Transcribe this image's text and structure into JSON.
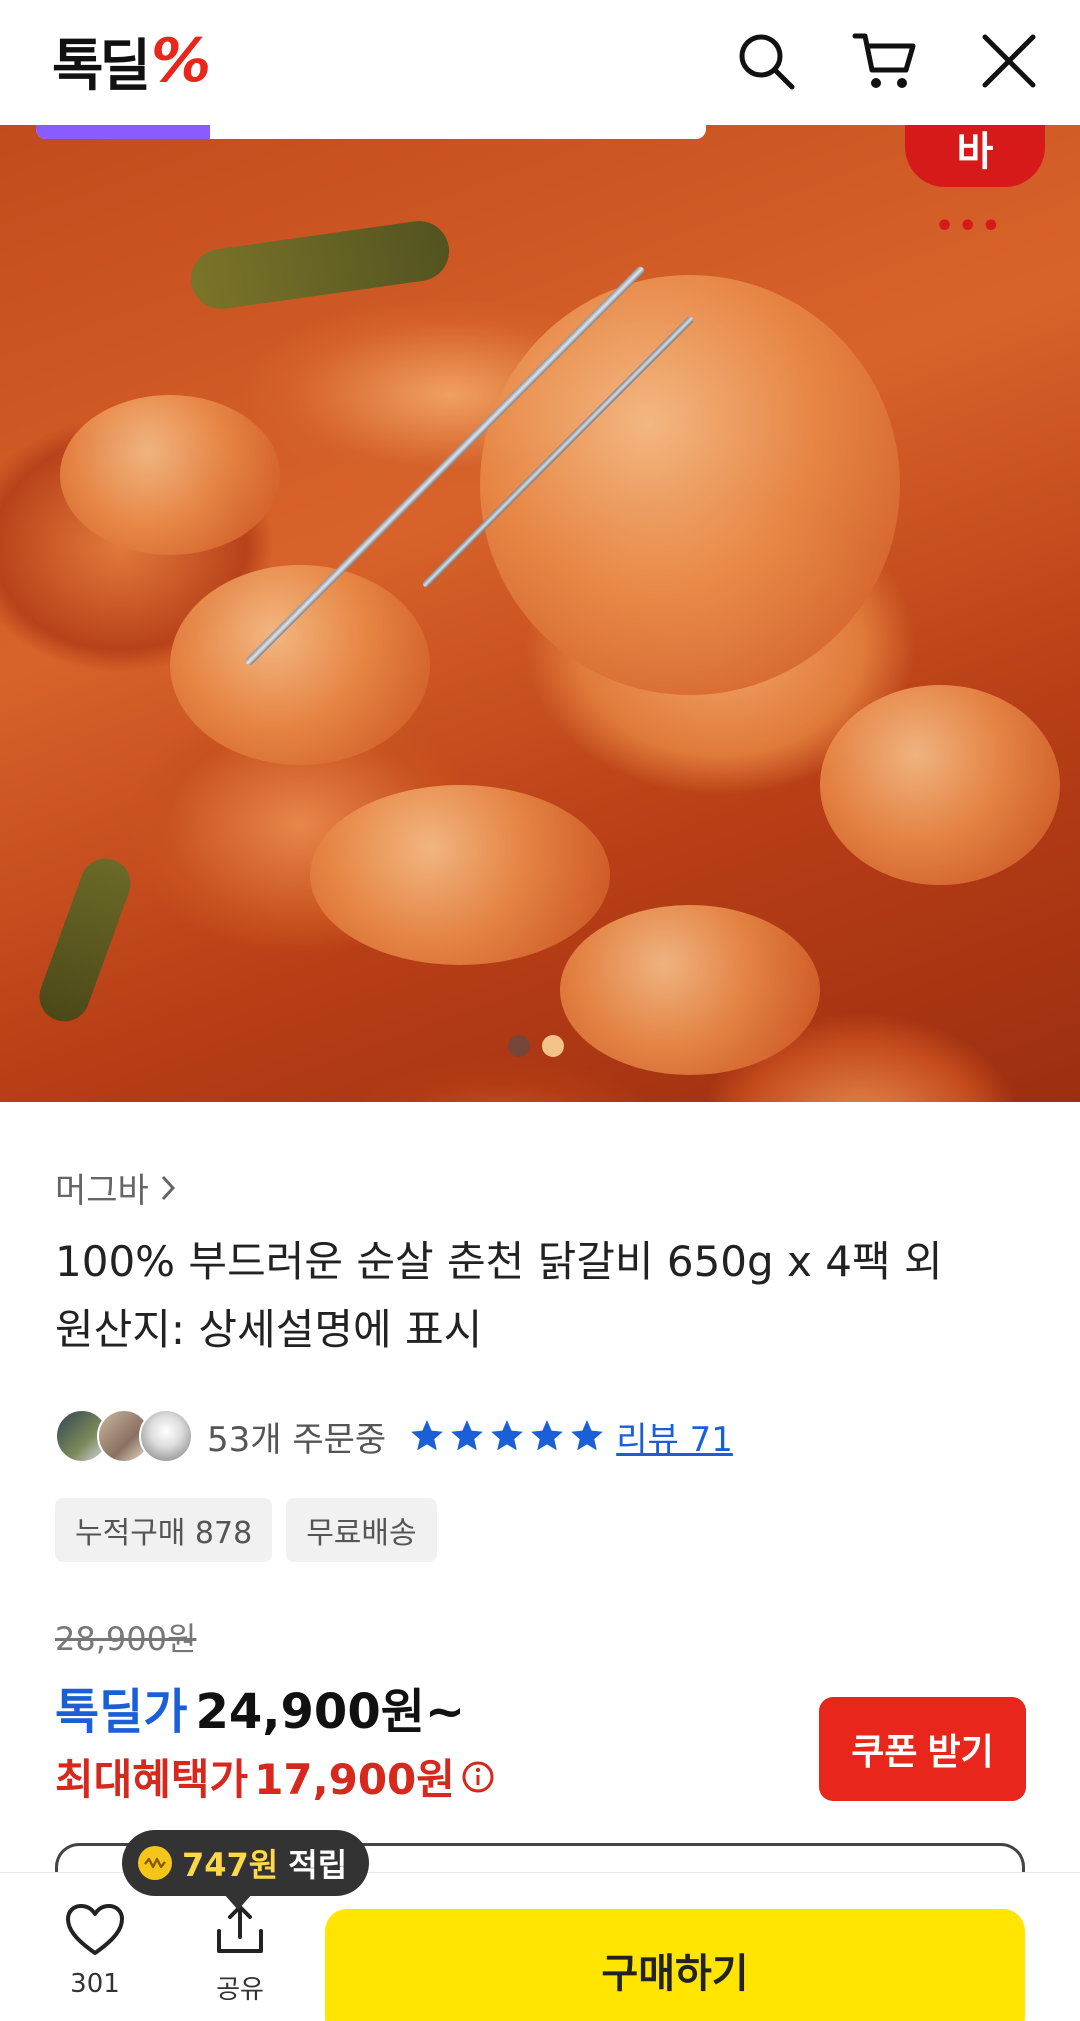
{
  "header": {
    "logo_text": "톡딜",
    "logo_mark": "%",
    "icons": [
      "search-icon",
      "cart-icon",
      "close-icon"
    ]
  },
  "hero": {
    "brand_badge": "바",
    "brand_dots": "•••",
    "image_progress": 0.26,
    "carousel_count": 2,
    "carousel_active": 1
  },
  "product": {
    "brand": "머그바",
    "title_line1": "100% 부드러운 순살 춘천 닭갈비 650g x 4팩 외",
    "title_line2": "원산지: 상세설명에 표시",
    "orders": "53개 주문중",
    "rating_stars": 5,
    "review_link": "리뷰 71",
    "tags": [
      "누적구매 878",
      "무료배송"
    ]
  },
  "price": {
    "original": "28,900원",
    "deal_label": "톡딜가",
    "deal_price": "24,900원~",
    "max_label": "최대혜택가",
    "max_price": "17,900원",
    "coupon_button": "쿠폰 받기"
  },
  "bottom_bar": {
    "like_count": "301",
    "share_label": "공유",
    "buy_button": "구매하기",
    "tooltip_amount": "747원",
    "tooltip_text": "적립"
  },
  "colors": {
    "accent_blue": "#1a5fd6",
    "accent_red": "#e8261c",
    "buy_yellow": "#ffe500",
    "progress_purple": "#8a5cff"
  }
}
